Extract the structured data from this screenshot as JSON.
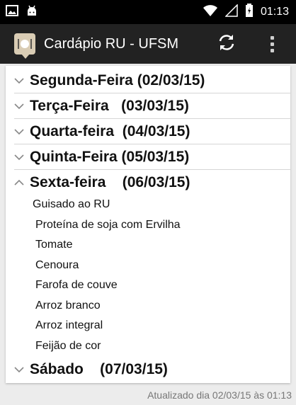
{
  "status_bar": {
    "time": "01:13"
  },
  "app": {
    "title": "Cardápio RU - UFSM"
  },
  "days": [
    {
      "label": "Segunda-Feira (02/03/15)",
      "expanded": false
    },
    {
      "label": "Terça-Feira   (03/03/15)",
      "expanded": false
    },
    {
      "label": "Quarta-feira  (04/03/15)",
      "expanded": false
    },
    {
      "label": "Quinta-Feira (05/03/15)",
      "expanded": false
    },
    {
      "label": "Sexta-feira    (06/03/15)",
      "expanded": true
    },
    {
      "label": "Sábado    (07/03/15)",
      "expanded": false
    }
  ],
  "friday_menu": [
    "Guisado ao RU",
    "Proteína de soja com Ervilha",
    "Tomate",
    "Cenoura",
    "Farofa de couve",
    "Arroz branco",
    "Arroz integral",
    "Feijão de cor"
  ],
  "footer": {
    "updated": "Atualizado dia 02/03/15 às 01:13"
  },
  "colors": {
    "action_bar": "#222222",
    "status_bar": "#000000",
    "background": "#ececec"
  },
  "icons": [
    "picture-icon",
    "android-icon",
    "wifi-icon",
    "signal-icon",
    "battery-icon",
    "refresh-icon",
    "overflow-menu-icon"
  ]
}
